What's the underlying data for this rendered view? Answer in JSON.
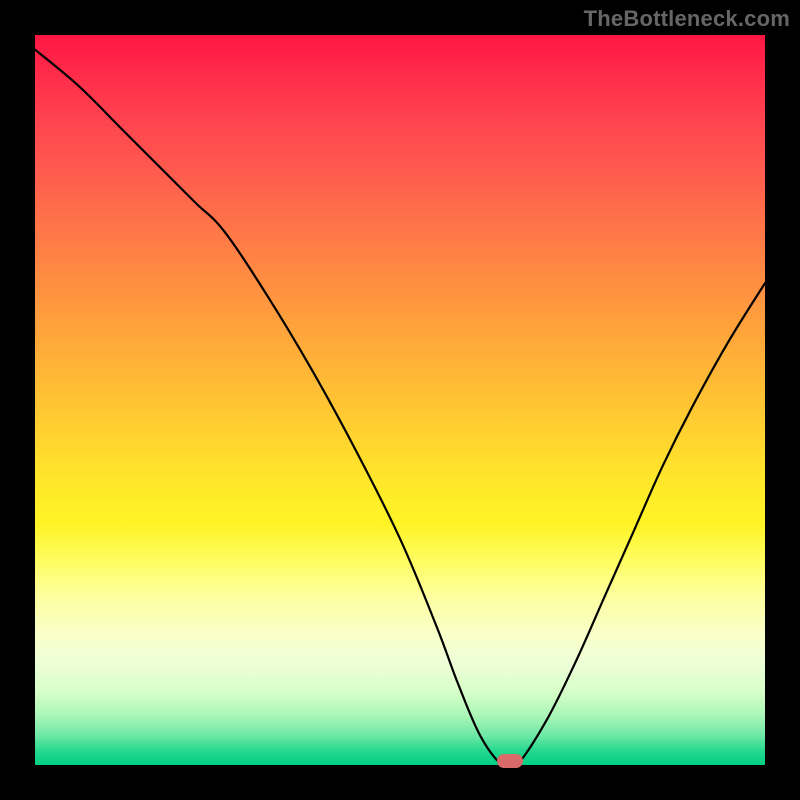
{
  "watermark": "TheBottleneck.com",
  "chart_data": {
    "type": "line",
    "title": "",
    "xlabel": "",
    "ylabel": "",
    "xlim": [
      0,
      100
    ],
    "ylim": [
      0,
      100
    ],
    "gradient_levels": [
      {
        "stop": 0,
        "color": "#ff1744"
      },
      {
        "stop": 50,
        "color": "#ffc628"
      },
      {
        "stop": 75,
        "color": "#fffb70"
      },
      {
        "stop": 90,
        "color": "#c8ffbc"
      },
      {
        "stop": 100,
        "color": "#00d084"
      }
    ],
    "series": [
      {
        "name": "bottleneck-curve",
        "x": [
          0,
          6,
          12,
          18,
          22,
          26,
          32,
          38,
          44,
          50,
          55,
          58,
          61,
          64,
          66,
          70,
          74,
          78,
          82,
          86,
          90,
          95,
          100
        ],
        "y": [
          98,
          93,
          87,
          81,
          77,
          73,
          64,
          54,
          43,
          31,
          19,
          11,
          4,
          0,
          0,
          6,
          14,
          23,
          32,
          41,
          49,
          58,
          66
        ]
      }
    ],
    "marker": {
      "x": 65,
      "y": 0.5,
      "color": "#d96a6a"
    }
  }
}
